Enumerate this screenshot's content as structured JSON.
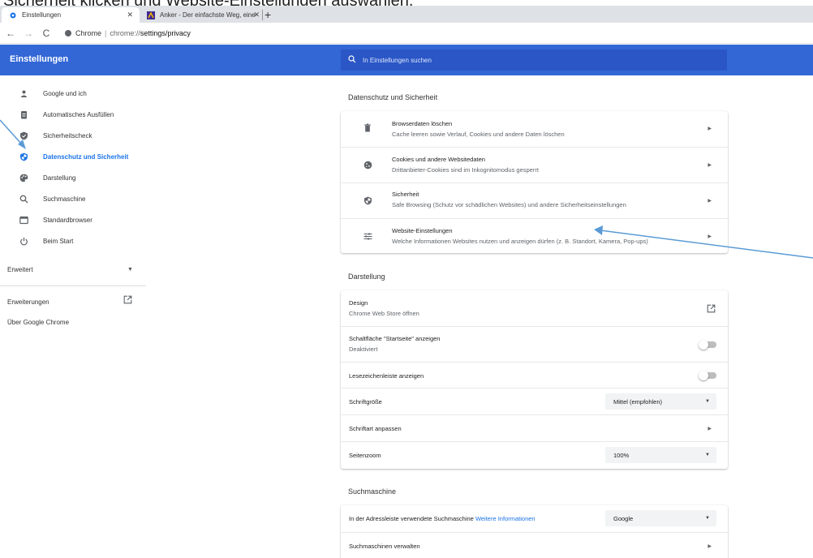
{
  "caption": "Sicherheit klicken und Website-Einstellungen auswählen.",
  "tabs": [
    {
      "title": "Einstellungen",
      "active": true
    },
    {
      "title": "Anker - Der einfachste Weg, eine",
      "active": false
    }
  ],
  "address": {
    "scheme_label": "Chrome",
    "url_host": "chrome://",
    "url_path": "settings/privacy"
  },
  "header": {
    "title": "Einstellungen",
    "search_placeholder": "In Einstellungen suchen"
  },
  "sidebar": {
    "items": [
      {
        "label": "Google und ich",
        "icon": "person-icon"
      },
      {
        "label": "Automatisches Ausfüllen",
        "icon": "clipboard-icon"
      },
      {
        "label": "Sicherheitscheck",
        "icon": "shield-check-icon"
      },
      {
        "label": "Datenschutz und Sicherheit",
        "icon": "shield-icon",
        "selected": true
      },
      {
        "label": "Darstellung",
        "icon": "palette-icon"
      },
      {
        "label": "Suchmaschine",
        "icon": "search-icon"
      },
      {
        "label": "Standardbrowser",
        "icon": "browser-icon"
      },
      {
        "label": "Beim Start",
        "icon": "power-icon"
      }
    ],
    "advanced": "Erweitert",
    "extensions": "Erweiterungen",
    "about": "Über Google Chrome"
  },
  "privacy": {
    "title": "Datenschutz und Sicherheit",
    "rows": [
      {
        "title": "Browserdaten löschen",
        "subtitle": "Cache leeren sowie Verlauf, Cookies und andere Daten löschen",
        "icon": "trash-icon"
      },
      {
        "title": "Cookies und andere Websitedaten",
        "subtitle": "Drittanbieter-Cookies sind im Inkognitomodus gesperrt",
        "icon": "cookie-icon"
      },
      {
        "title": "Sicherheit",
        "subtitle": "Safe Browsing (Schutz vor schädlichen Websites) und andere Sicherheitseinstellungen",
        "icon": "shield-icon"
      },
      {
        "title": "Website-Einstellungen",
        "subtitle": "Welche Informationen Websites nutzen und anzeigen dürfen (z. B. Standort, Kamera, Pop-ups)",
        "icon": "sliders-icon"
      }
    ]
  },
  "appearance": {
    "title": "Darstellung",
    "design_title": "Design",
    "design_sub": "Chrome Web Store öffnen",
    "home_title": "Schaltfläche \"Startseite\" anzeigen",
    "home_sub": "Deaktiviert",
    "bookmarks_title": "Lesezeichenleiste anzeigen",
    "fontsize_title": "Schriftgröße",
    "fontsize_value": "Mittel (empfohlen)",
    "font_custom_title": "Schriftart anpassen",
    "zoom_title": "Seitenzoom",
    "zoom_value": "100%"
  },
  "search": {
    "title": "Suchmaschine",
    "engine_label": "In der Adressleiste verwendete Suchmaschine",
    "engine_link": "Weitere Informationen",
    "engine_value": "Google",
    "manage_label": "Suchmaschinen verwalten"
  },
  "colors": {
    "header_blue": "#3367d6",
    "accent": "#1a73e8",
    "arrow": "#5b9bd5"
  }
}
